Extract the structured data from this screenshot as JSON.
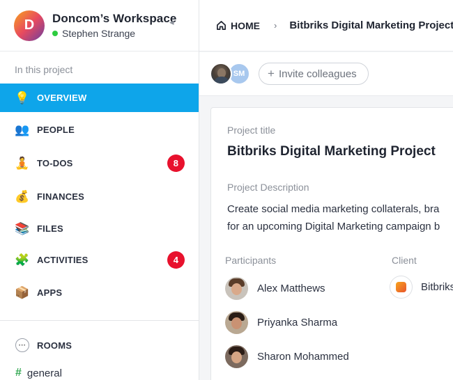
{
  "workspace": {
    "name": "Doncom’s Workspace",
    "logo_letter": "D",
    "user": "Stephen Strange",
    "online_color": "#2ecc40"
  },
  "sidebar": {
    "section_label": "In this project",
    "items": [
      {
        "label": "OVERVIEW",
        "icon": "lightbulb-icon",
        "glyph": "💡",
        "active": true
      },
      {
        "label": "PEOPLE",
        "icon": "people-icon",
        "glyph": "👥"
      },
      {
        "label": "TO-DOS",
        "icon": "meditation-icon",
        "glyph": "🧘",
        "badge": "8"
      },
      {
        "label": "FINANCES",
        "icon": "money-bag-icon",
        "glyph": "💰"
      },
      {
        "label": "FILES",
        "icon": "books-icon",
        "glyph": "📚"
      },
      {
        "label": "ACTIVITIES",
        "icon": "puzzle-icon",
        "glyph": "🧩",
        "badge": "4"
      },
      {
        "label": "APPS",
        "icon": "package-icon",
        "glyph": "📦"
      }
    ],
    "rooms_label": "ROOMS",
    "channel": "general"
  },
  "breadcrumb": {
    "home": "HOME",
    "separator": "›",
    "current": "Bitbriks Digital Marketing Project"
  },
  "members": {
    "initials": "SM",
    "invite_label": "Invite colleagues"
  },
  "project": {
    "title_label": "Project title",
    "title": "Bitbriks Digital Marketing Project",
    "description_label": "Project Description",
    "description_line1": "Create social media marketing collaterals, bra",
    "description_line2": "for an upcoming Digital Marketing campaign b",
    "participants_label": "Participants",
    "client_label": "Client",
    "participants": [
      "Alex Matthews",
      "Priyanka Sharma",
      "Sharon Mohammed"
    ],
    "client": "Bitbriks"
  },
  "colors": {
    "accent": "#0ea5ea",
    "badge": "#e8112d"
  }
}
